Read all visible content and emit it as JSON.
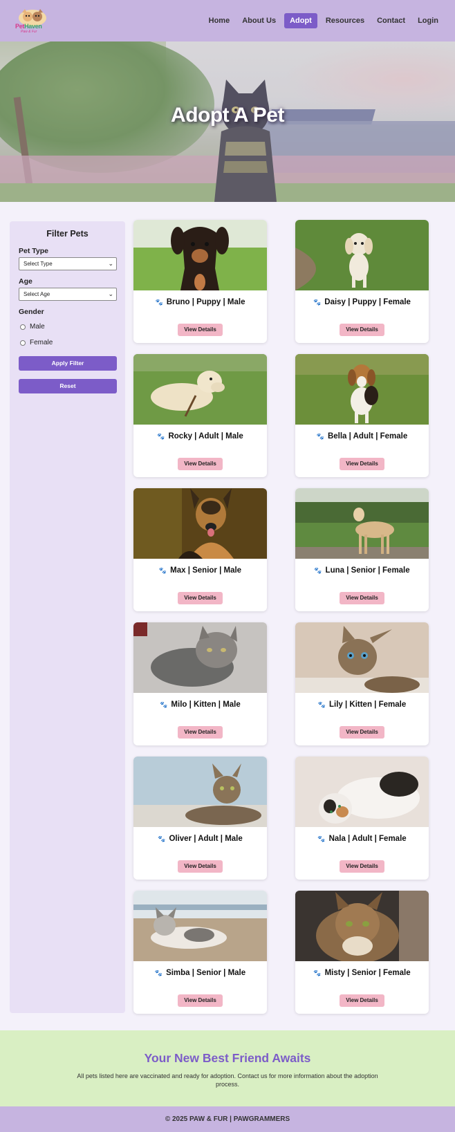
{
  "header": {
    "logo_text_a": "Pet",
    "logo_text_b": "Haven",
    "logo_sub": "Paw & Fur",
    "nav": [
      "Home",
      "About Us",
      "Adopt",
      "Resources",
      "Contact",
      "Login"
    ],
    "active": "Adopt"
  },
  "hero": {
    "title": "Adopt A Pet"
  },
  "filter": {
    "title": "Filter Pets",
    "pet_type_label": "Pet Type",
    "pet_type_value": "Select Type",
    "age_label": "Age",
    "age_value": "Select Age",
    "gender_label": "Gender",
    "gender_options": [
      "Male",
      "Female"
    ],
    "apply_label": "Apply Filter",
    "reset_label": "Reset"
  },
  "pets": [
    {
      "title": "Bruno | Puppy | Male",
      "photo": "dachshund-puppy-photo"
    },
    {
      "title": "Daisy | Puppy | Female",
      "photo": "retriever-puppy-photo"
    },
    {
      "title": "Rocky | Adult | Male",
      "photo": "labrador-photo"
    },
    {
      "title": "Bella | Adult | Female",
      "photo": "beagle-photo"
    },
    {
      "title": "Max | Senior | Male",
      "photo": "german-shepherd-photo"
    },
    {
      "title": "Luna | Senior | Female",
      "photo": "tan-dog-photo"
    },
    {
      "title": "Milo | Kitten | Male",
      "photo": "grey-tabby-kitten-photo"
    },
    {
      "title": "Lily | Kitten | Female",
      "photo": "tabby-kitten-photo"
    },
    {
      "title": "Oliver | Adult | Male",
      "photo": "tabby-cat-photo"
    },
    {
      "title": "Nala | Adult | Female",
      "photo": "calico-cat-photo"
    },
    {
      "title": "Simba | Senior | Male",
      "photo": "white-grey-cat-photo"
    },
    {
      "title": "Misty | Senior | Female",
      "photo": "longhair-cat-photo"
    }
  ],
  "card_button_label": "View Details",
  "paw_icon": "🐾",
  "banner": {
    "title": "Your New Best Friend Awaits",
    "text": "All pets listed here are vaccinated and ready for adoption. Contact us for more information about the adoption process."
  },
  "footer": {
    "text": "© 2025 PAW & FUR | PAWGRAMMERS"
  },
  "colors": {
    "header": "#c6b4e0",
    "accent": "#7c5cc8",
    "button_pink": "#f2b6c6",
    "banner": "#d9efc3",
    "sidebar": "#e8e0f5"
  }
}
